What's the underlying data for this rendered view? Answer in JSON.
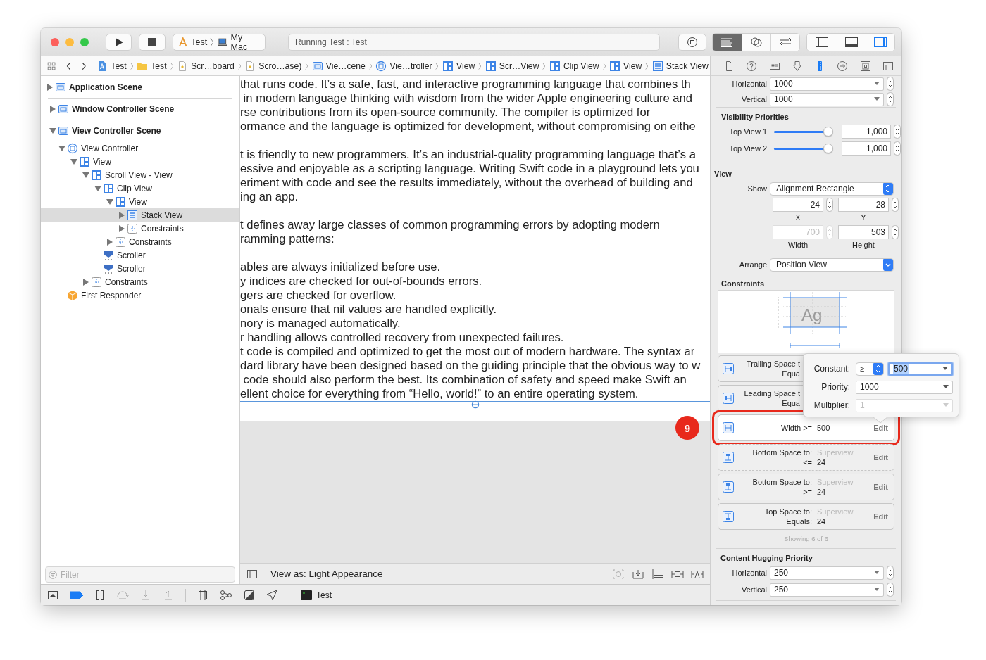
{
  "toolbar": {
    "scheme": [
      {
        "label": "Test",
        "kind": "app"
      },
      {
        "label": "My Mac",
        "kind": "laptop"
      }
    ],
    "activity": "Running Test : Test",
    "editor_modes": [
      {
        "selected": true
      },
      {
        "selected": false
      },
      {
        "selected": false
      }
    ],
    "panels": [
      {
        "on": false
      },
      {
        "on": false
      },
      {
        "on": true
      }
    ]
  },
  "jump_bar": [
    {
      "label": "Test",
      "kind": "project"
    },
    {
      "label": "Test",
      "kind": "folder"
    },
    {
      "label": "Scr…board",
      "kind": "file"
    },
    {
      "label": "Scro…ase)",
      "kind": "file"
    },
    {
      "label": "Vie…cene",
      "kind": "scene"
    },
    {
      "label": "Vie…troller",
      "kind": "controller"
    },
    {
      "label": "View",
      "kind": "view"
    },
    {
      "label": "Scr…View",
      "kind": "view"
    },
    {
      "label": "Clip View",
      "kind": "view"
    },
    {
      "label": "View",
      "kind": "view"
    },
    {
      "label": "Stack View",
      "kind": "stack"
    }
  ],
  "outline": [
    {
      "label": "Application Scene",
      "kind": "scene",
      "expanded": false,
      "selected": false
    },
    {
      "label": "Window Controller Scene",
      "kind": "scene",
      "expanded": false,
      "selected": false
    },
    {
      "label": "View Controller Scene",
      "kind": "scene",
      "expanded": true,
      "selected": false,
      "children": [
        {
          "label": "View Controller",
          "kind": "controller",
          "expanded": true,
          "selected": false,
          "children": [
            {
              "label": "View",
              "kind": "view",
              "expanded": true,
              "selected": false,
              "children": [
                {
                  "label": "Scroll View - View",
                  "kind": "view",
                  "expanded": true,
                  "selected": false,
                  "children": [
                    {
                      "label": "Clip View",
                      "kind": "view",
                      "expanded": true,
                      "selected": false,
                      "children": [
                        {
                          "label": "View",
                          "kind": "view",
                          "expanded": true,
                          "selected": false,
                          "children": [
                            {
                              "label": "Stack View",
                              "kind": "stack",
                              "expanded": false,
                              "selected": true
                            },
                            {
                              "label": "Constraints",
                              "kind": "constraints",
                              "expanded": false,
                              "selected": false
                            }
                          ]
                        },
                        {
                          "label": "Constraints",
                          "kind": "constraints",
                          "expanded": false,
                          "selected": false
                        }
                      ]
                    },
                    {
                      "label": "Scroller",
                      "kind": "scroller",
                      "selected": false
                    },
                    {
                      "label": "Scroller",
                      "kind": "scroller",
                      "selected": false
                    }
                  ]
                },
                {
                  "label": "Constraints",
                  "kind": "constraints",
                  "expanded": false,
                  "selected": false
                }
              ]
            }
          ]
        },
        {
          "label": "First Responder",
          "kind": "responder",
          "selected": false
        }
      ]
    }
  ],
  "filter": {
    "placeholder": "Filter"
  },
  "canvas": {
    "paragraphs": [
      [
        "that runs code. It’s a safe, fast, and interactive programming language that combines th",
        " in modern language thinking with wisdom from the wider Apple engineering culture and",
        "rse contributions from its open-source community. The compiler is optimized for",
        "ormance and the language is optimized for development, without compromising on eithe"
      ],
      [
        "t is friendly to new programmers. It’s an industrial-quality programming language that’s a",
        "essive and enjoyable as a scripting language. Writing Swift code in a playground lets you",
        "eriment with code and see the results immediately, without the overhead of building and",
        "ing an app."
      ],
      [
        "t defines away large classes of common programming errors by adopting modern",
        "ramming patterns:"
      ],
      [
        "ables are always initialized before use.",
        "y indices are checked for out-of-bounds errors.",
        "gers are checked for overflow.",
        "onals ensure that nil values are handled explicitly.",
        "nory is managed automatically.",
        "r handling allows controlled recovery from unexpected failures.",
        "t code is compiled and optimized to get the most out of modern hardware. The syntax ar",
        "dard library have been designed based on the guiding principle that the obvious way to w",
        " code should also perform the best. Its combination of safety and speed make Swift an",
        "ellent choice for everything from “Hello, world!” to an entire operating system."
      ]
    ],
    "view_as": "View as: Light Appearance"
  },
  "debug_bar": {
    "breakpoints_on": true,
    "target": "Test"
  },
  "inspector": {
    "tabs": [
      {
        "selected": false
      },
      {
        "selected": false
      },
      {
        "selected": false
      },
      {
        "selected": false
      },
      {
        "selected": true
      },
      {
        "selected": false
      },
      {
        "selected": false
      },
      {
        "selected": false
      }
    ],
    "hold_priorities": [
      {
        "label": "Horizontal",
        "value": "1000"
      },
      {
        "label": "Vertical",
        "value": "1000"
      }
    ],
    "visibility_title": "Visibility Priorities",
    "visibility": [
      {
        "label": "Top View 1",
        "level": 1,
        "value": "1,000"
      },
      {
        "label": "Top View 2",
        "level": 1,
        "value": "1,000"
      }
    ],
    "view_title": "View",
    "show": {
      "label": "Show",
      "value": "Alignment Rectangle"
    },
    "frame": [
      {
        "label": "X",
        "value": "24",
        "disabled": false
      },
      {
        "label": "Y",
        "value": "28",
        "disabled": false
      },
      {
        "label": "Width",
        "value": "700",
        "disabled": true
      },
      {
        "label": "Height",
        "value": "503",
        "disabled": false
      }
    ],
    "arrange": {
      "label": "Arrange",
      "value": "Position View"
    },
    "constraints_title": "Constraints",
    "diagram_text": "Ag",
    "constraints": [
      {
        "kind": "covered",
        "label": "Trailing Space t",
        "relation": "Equa",
        "dashed": false,
        "selected": false
      },
      {
        "kind": "covered",
        "label": "Leading Space t",
        "relation": "Equa",
        "dashed": false,
        "selected": false
      },
      {
        "kind": "single",
        "label": "Width >=",
        "value": "500",
        "edit": "Edit",
        "dashed": false,
        "selected": true,
        "callout": "9"
      },
      {
        "kind": "pair",
        "label": "Bottom Space to:",
        "target": "Superview",
        "relation": "<=",
        "value": "24",
        "edit": "Edit",
        "dashed": true,
        "selected": false
      },
      {
        "kind": "pair",
        "label": "Bottom Space to:",
        "target": "Superview",
        "relation": ">=",
        "value": "24",
        "edit": "Edit",
        "dashed": true,
        "selected": false
      },
      {
        "kind": "pair",
        "label": "Top Space to:",
        "target": "Superview",
        "relation": "Equals:",
        "value": "24",
        "edit": "Edit",
        "dashed": false,
        "selected": false
      }
    ],
    "showing": "Showing 6 of 6",
    "hugging_title": "Content Hugging Priority",
    "hugging": [
      {
        "label": "Horizontal",
        "value": "250"
      },
      {
        "label": "Vertical",
        "value": "250"
      }
    ]
  },
  "popover": {
    "rows": [
      {
        "kind": "relation",
        "label": "Constant:",
        "relation": "≥",
        "value": "500"
      },
      {
        "kind": "combo",
        "label": "Priority:",
        "value": "1000"
      },
      {
        "kind": "disabled",
        "label": "Multiplier:",
        "value": "1"
      }
    ]
  }
}
